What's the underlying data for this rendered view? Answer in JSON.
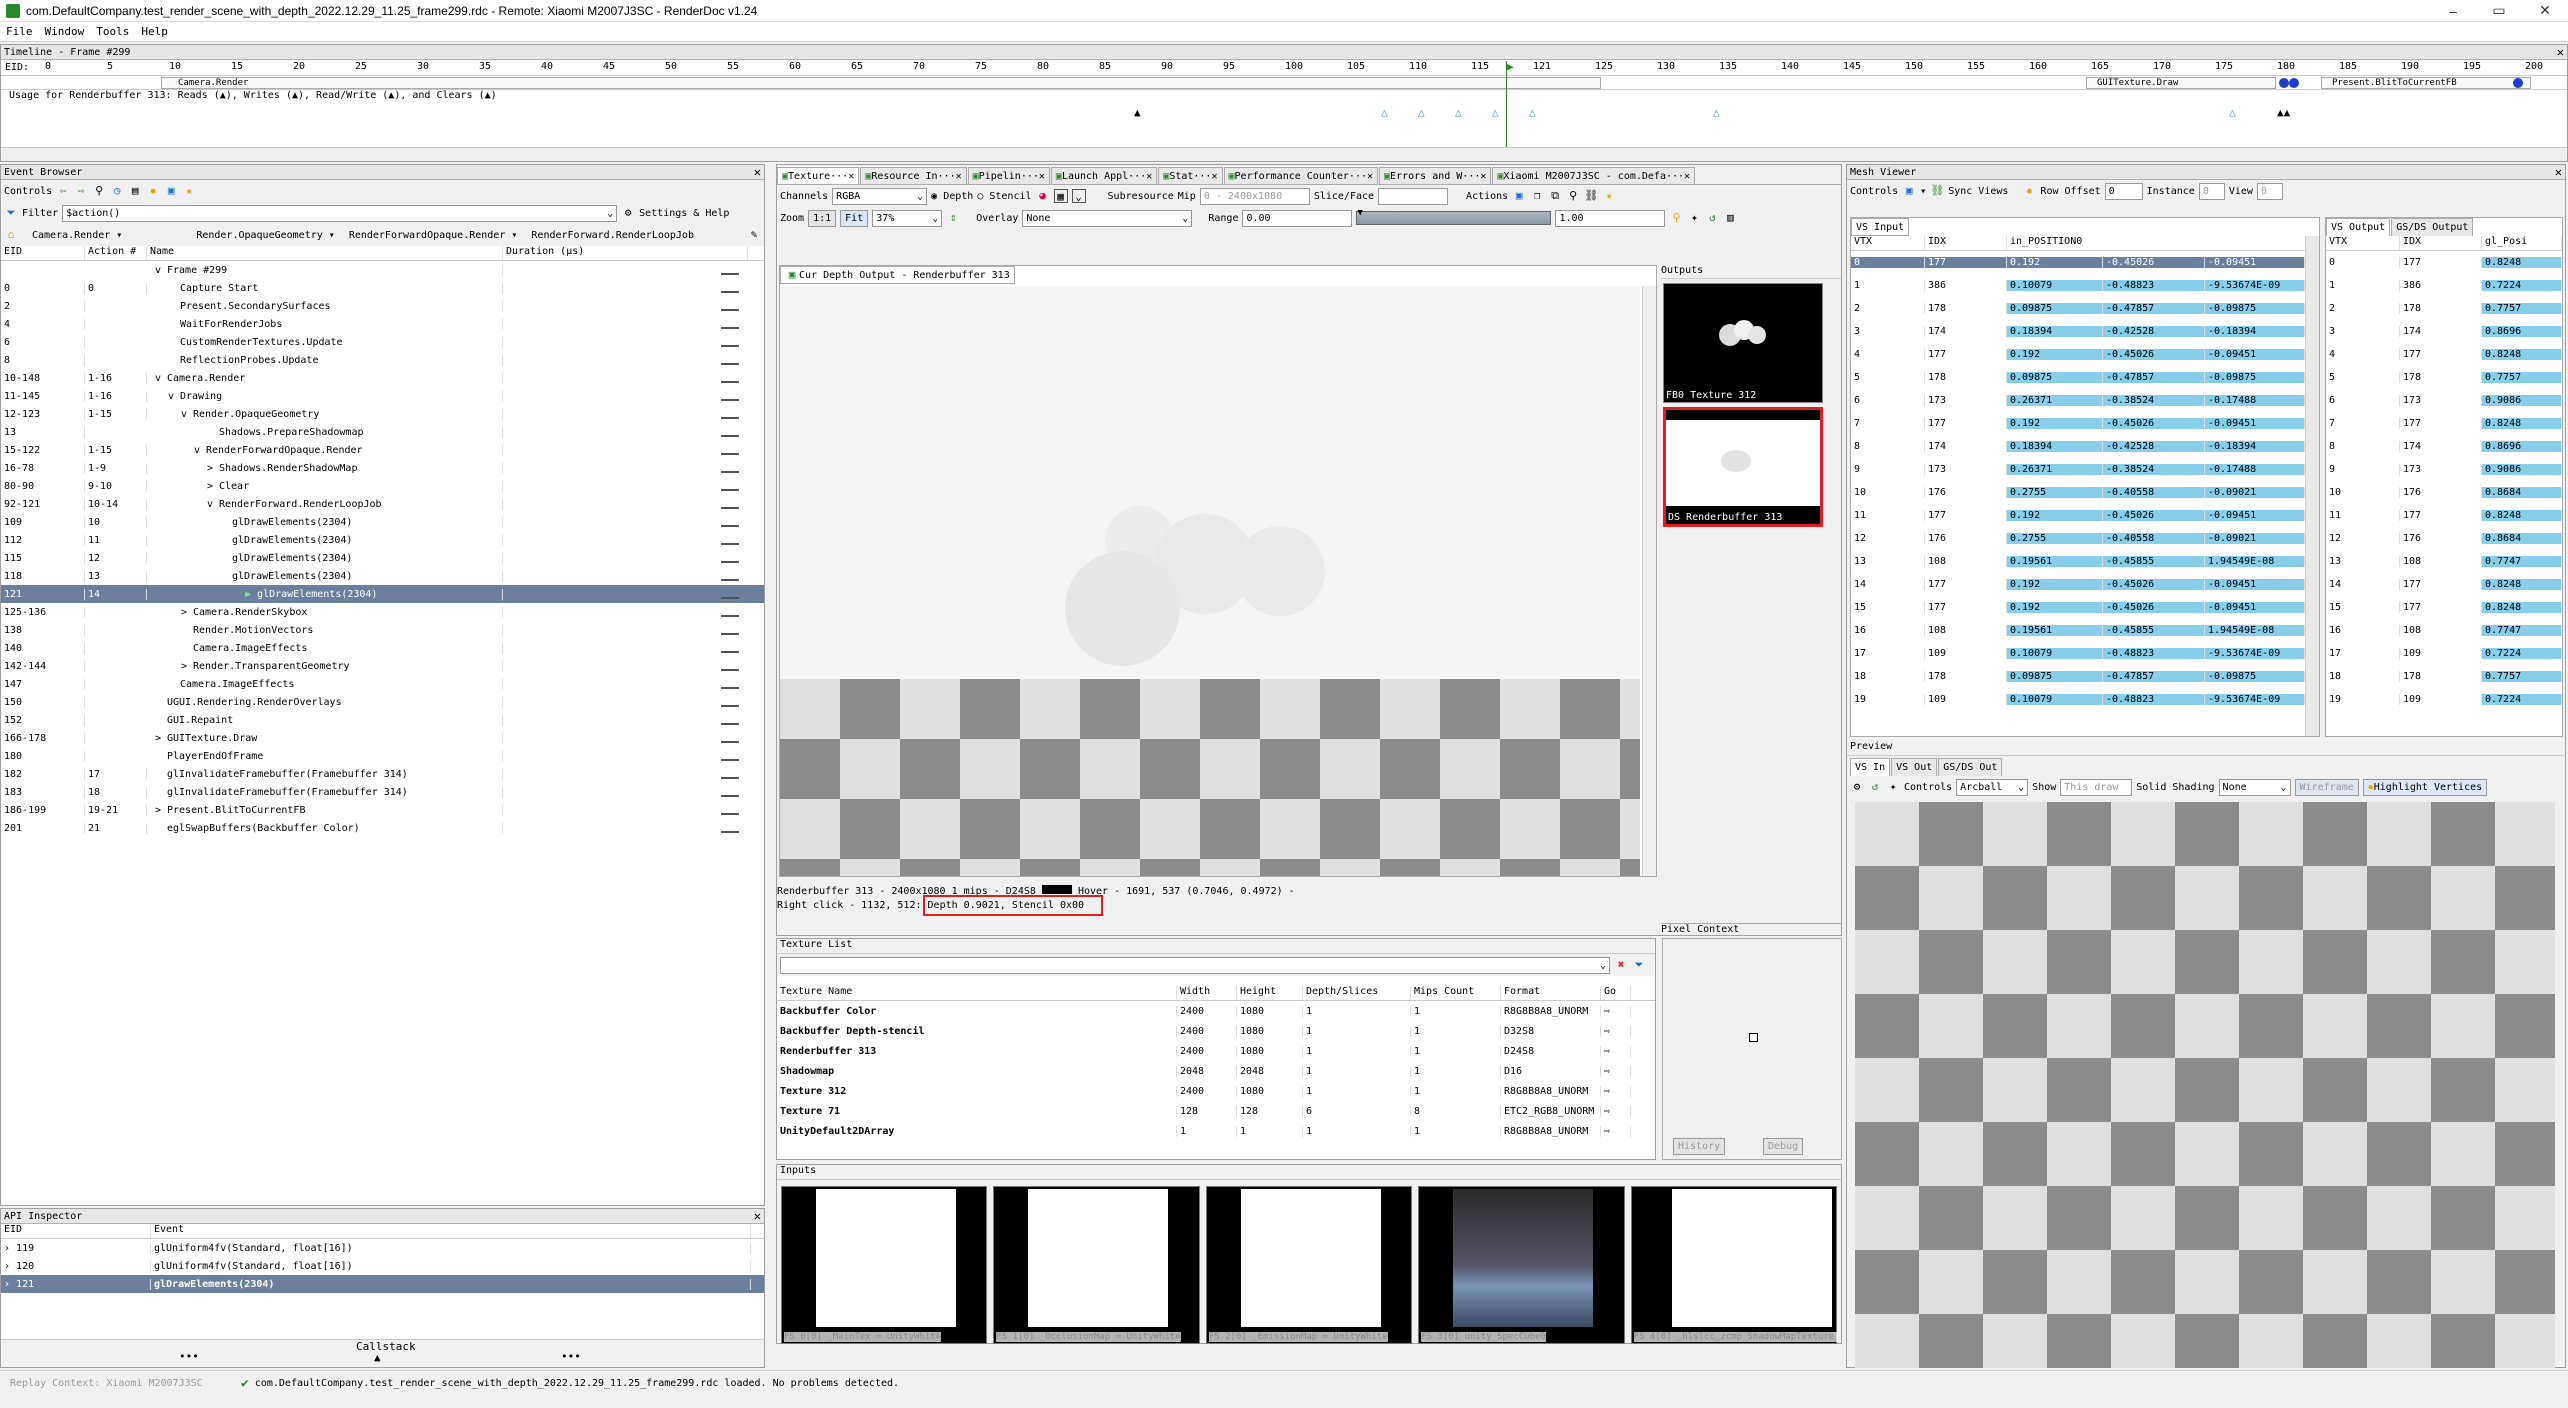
{
  "window": {
    "title": "com.DefaultCompany.test_render_scene_with_depth_2022.12.29_11.25_frame299.rdc - Remote: Xiaomi M2007J3SC - RenderDoc v1.24",
    "min": "–",
    "max": "▭",
    "close": "✕"
  },
  "menu": [
    "File",
    "Window",
    "Tools",
    "Help"
  ],
  "timeline": {
    "title": "Timeline - Frame #299",
    "eid_label": "EID:",
    "ticks": [
      "0",
      "5",
      "10",
      "15",
      "20",
      "25",
      "30",
      "35",
      "40",
      "45",
      "50",
      "55",
      "60",
      "65",
      "70",
      "75",
      "80",
      "85",
      "90",
      "95",
      "100",
      "105",
      "110",
      "115",
      "121",
      "125",
      "130",
      "135",
      "140",
      "145",
      "150",
      "155",
      "160",
      "165",
      "170",
      "175",
      "180",
      "185",
      "190",
      "195",
      "200"
    ],
    "camera": "Camera.Render",
    "guitex": "GUITexture.Draw",
    "present": "Present.BlitToCurrentFB",
    "usage": "Usage for Renderbuffer 313: Reads (▲), Writes (▲), Read/Write (▲), and Clears (▲)"
  },
  "event_browser": {
    "title": "Event Browser",
    "controls": "Controls",
    "filter_label": "Filter",
    "filter_value": "$action()",
    "settings": "Settings & Help",
    "crumbs": [
      "Camera.Render",
      "Render.OpaqueGeometry",
      "RenderForwardOpaque.Render",
      "RenderForward.RenderLoopJob"
    ],
    "headers": [
      "EID",
      "Action #",
      "Name",
      "Duration (µs)"
    ],
    "rows": [
      {
        "eid": "",
        "act": "",
        "name": "Frame #299",
        "ind": 0,
        "exp": "v"
      },
      {
        "eid": "0",
        "act": "0",
        "name": "Capture Start",
        "ind": 1,
        "exp": ""
      },
      {
        "eid": "2",
        "act": "",
        "name": "Present.SecondarySurfaces",
        "ind": 1,
        "exp": ""
      },
      {
        "eid": "4",
        "act": "",
        "name": "WaitForRenderJobs",
        "ind": 1,
        "exp": ""
      },
      {
        "eid": "6",
        "act": "",
        "name": "CustomRenderTextures.Update",
        "ind": 1,
        "exp": ""
      },
      {
        "eid": "8",
        "act": "",
        "name": "ReflectionProbes.Update",
        "ind": 1,
        "exp": ""
      },
      {
        "eid": "10-148",
        "act": "1-16",
        "name": "Camera.Render",
        "ind": 0,
        "exp": "v"
      },
      {
        "eid": "11-145",
        "act": "1-16",
        "name": "Drawing",
        "ind": 1,
        "exp": "v"
      },
      {
        "eid": "12-123",
        "act": "1-15",
        "name": "Render.OpaqueGeometry",
        "ind": 2,
        "exp": "v"
      },
      {
        "eid": "13",
        "act": "",
        "name": "Shadows.PrepareShadowmap",
        "ind": 4,
        "exp": ""
      },
      {
        "eid": "15-122",
        "act": "1-15",
        "name": "RenderForwardOpaque.Render",
        "ind": 3,
        "exp": "v"
      },
      {
        "eid": "16-78",
        "act": "1-9",
        "name": "Shadows.RenderShadowMap",
        "ind": 4,
        "exp": ">"
      },
      {
        "eid": "80-90",
        "act": "9-10",
        "name": "Clear",
        "ind": 4,
        "exp": ">"
      },
      {
        "eid": "92-121",
        "act": "10-14",
        "name": "RenderForward.RenderLoopJob",
        "ind": 4,
        "exp": "v"
      },
      {
        "eid": "109",
        "act": "10",
        "name": "glDrawElements(2304)",
        "ind": 5,
        "exp": ""
      },
      {
        "eid": "112",
        "act": "11",
        "name": "glDrawElements(2304)",
        "ind": 5,
        "exp": ""
      },
      {
        "eid": "115",
        "act": "12",
        "name": "glDrawElements(2304)",
        "ind": 5,
        "exp": ""
      },
      {
        "eid": "118",
        "act": "13",
        "name": "glDrawElements(2304)",
        "ind": 5,
        "exp": ""
      },
      {
        "eid": "121",
        "act": "14",
        "name": "glDrawElements(2304)",
        "ind": 6,
        "exp": "",
        "sel": true
      },
      {
        "eid": "125-136",
        "act": "",
        "name": "Camera.RenderSkybox",
        "ind": 2,
        "exp": ">"
      },
      {
        "eid": "138",
        "act": "",
        "name": "Render.MotionVectors",
        "ind": 2,
        "exp": ""
      },
      {
        "eid": "140",
        "act": "",
        "name": "Camera.ImageEffects",
        "ind": 2,
        "exp": ""
      },
      {
        "eid": "142-144",
        "act": "",
        "name": "Render.TransparentGeometry",
        "ind": 2,
        "exp": ">"
      },
      {
        "eid": "147",
        "act": "",
        "name": "Camera.ImageEffects",
        "ind": 1,
        "exp": ""
      },
      {
        "eid": "150",
        "act": "",
        "name": "UGUI.Rendering.RenderOverlays",
        "ind": 0,
        "exp": ""
      },
      {
        "eid": "152",
        "act": "",
        "name": "GUI.Repaint",
        "ind": 0,
        "exp": ""
      },
      {
        "eid": "166-178",
        "act": "",
        "name": "GUITexture.Draw",
        "ind": 0,
        "exp": ">"
      },
      {
        "eid": "180",
        "act": "",
        "name": "PlayerEndOfFrame",
        "ind": 0,
        "exp": ""
      },
      {
        "eid": "182",
        "act": "17",
        "name": "glInvalidateFramebuffer(Framebuffer 314)",
        "ind": 0,
        "exp": ""
      },
      {
        "eid": "183",
        "act": "18",
        "name": "glInvalidateFramebuffer(Framebuffer 314)",
        "ind": 0,
        "exp": ""
      },
      {
        "eid": "186-199",
        "act": "19-21",
        "name": "Present.BlitToCurrentFB",
        "ind": 0,
        "exp": ">"
      },
      {
        "eid": "201",
        "act": "21",
        "name": "eglSwapBuffers(Backbuffer Color)",
        "ind": 0,
        "exp": ""
      }
    ]
  },
  "api_inspector": {
    "title": "API Inspector",
    "headers": [
      "EID",
      "Event"
    ],
    "rows": [
      {
        "eid": "119",
        "ev": "glUniform4fv(Standard,  float[16])"
      },
      {
        "eid": "120",
        "ev": "glUniform4fv(Standard,  float[16])"
      },
      {
        "eid": "121",
        "ev": "glDrawElements(2304)",
        "sel": true
      }
    ],
    "callstack": "Callstack",
    "dots": "•••"
  },
  "texture_viewer": {
    "tabs": [
      "Texture···",
      "Resource In···",
      "Pipelin···",
      "Launch Appl···",
      "Stat···",
      "Performance Counter···",
      "Errors and W···",
      "Xiaomi M2007J3SC - com.Defa···"
    ],
    "channels_label": "Channels",
    "channels": "RGBA",
    "depth": "Depth",
    "stencil": "Stencil",
    "subresource": "Subresource",
    "mip": "Mip",
    "mip_val": "0 - 2400x1080",
    "slice": "Slice/Face",
    "actions": "Actions",
    "zoom_label": "Zoom",
    "zoom_11": "1:1",
    "fit": "Fit",
    "zoom": "37%",
    "overlay_label": "Overlay",
    "overlay": "None",
    "range_label": "Range",
    "range_min": "0.00",
    "range_max": "1.00",
    "subtab": "Cur Depth Output - Renderbuffer 313",
    "outputs_label": "Outputs",
    "out1": "FB0    Texture 312",
    "out2": "DS    Renderbuffer 313",
    "status1": "Renderbuffer 313 - 2400x1080 1 mips - D24S8",
    "status1b": "Hover -   1691,   537 (0.7046, 0.4972)  -",
    "status2a": "Right click - 1132,   512:",
    "status2b": "Depth 0.9021, Stencil 0x00",
    "pixel_context": "Pixel Context",
    "history": "History",
    "debug": "Debug"
  },
  "texture_list": {
    "title": "Texture List",
    "headers": [
      "Texture Name",
      "Width",
      "Height",
      "Depth/Slices",
      "Mips Count",
      "Format",
      "Go"
    ],
    "rows": [
      [
        "Backbuffer Color",
        "2400",
        "1080",
        "1",
        "1",
        "R8G8B8A8_UNORM"
      ],
      [
        "Backbuffer Depth-stencil",
        "2400",
        "1080",
        "1",
        "1",
        "D32S8"
      ],
      [
        "Renderbuffer 313",
        "2400",
        "1080",
        "1",
        "1",
        "D24S8"
      ],
      [
        "Shadowmap",
        "2048",
        "2048",
        "1",
        "1",
        "D16"
      ],
      [
        "Texture 312",
        "2400",
        "1080",
        "1",
        "1",
        "R8G8B8A8_UNORM"
      ],
      [
        "Texture 71",
        "128",
        "128",
        "6",
        "8",
        "ETC2_RGB8_UNORM"
      ],
      [
        "UnityDefault2DArray",
        "1",
        "1",
        "1",
        "1",
        "R8G8B8A8_UNORM"
      ]
    ]
  },
  "inputs": {
    "title": "Inputs",
    "items": [
      "FS 0[0]    _MainTex = UnityWhite",
      "FS 1[0] _OcclusionMap = UnityWhite",
      "FS 2[0] _EmissionMap = UnityWhite",
      "FS 3[0]    unity_SpecCube0",
      "FS 4[0]  _hlslcc_zcmp_ShadowMapTexture = Shadowmap"
    ]
  },
  "mesh_viewer": {
    "title": "Mesh Viewer",
    "controls": "Controls",
    "sync": "Sync Views",
    "row_offset": "Row Offset",
    "row_offset_val": "0",
    "instance": "Instance",
    "instance_val": "0",
    "view": "View",
    "view_val": "0",
    "vs_input": "VS Input",
    "vs_output": "VS Output",
    "gsds_output": "GS/DS Output",
    "in_headers": [
      "VTX",
      "IDX",
      "in_POSITION0"
    ],
    "out_headers": [
      "VTX",
      "IDX",
      "gl_Posi"
    ],
    "rows": [
      [
        "0",
        "177",
        "0.192",
        "-0.45026",
        "-0.09451",
        "0.8248"
      ],
      [
        "1",
        "386",
        "0.10079",
        "-0.48823",
        "-9.53674E-09",
        "0.7224"
      ],
      [
        "2",
        "178",
        "0.09875",
        "-0.47857",
        "-0.09875",
        "0.7757"
      ],
      [
        "3",
        "174",
        "0.18394",
        "-0.42528",
        "-0.18394",
        "0.8696"
      ],
      [
        "4",
        "177",
        "0.192",
        "-0.45026",
        "-0.09451",
        "0.8248"
      ],
      [
        "5",
        "178",
        "0.09875",
        "-0.47857",
        "-0.09875",
        "0.7757"
      ],
      [
        "6",
        "173",
        "0.26371",
        "-0.38524",
        "-0.17488",
        "0.9086"
      ],
      [
        "7",
        "177",
        "0.192",
        "-0.45026",
        "-0.09451",
        "0.8248"
      ],
      [
        "8",
        "174",
        "0.18394",
        "-0.42528",
        "-0.18394",
        "0.8696"
      ],
      [
        "9",
        "173",
        "0.26371",
        "-0.38524",
        "-0.17488",
        "0.9086"
      ],
      [
        "10",
        "176",
        "0.2755",
        "-0.40558",
        "-0.09021",
        "0.8684"
      ],
      [
        "11",
        "177",
        "0.192",
        "-0.45026",
        "-0.09451",
        "0.8248"
      ],
      [
        "12",
        "176",
        "0.2755",
        "-0.40558",
        "-0.09021",
        "0.8684"
      ],
      [
        "13",
        "108",
        "0.19561",
        "-0.45855",
        "1.94549E-08",
        "0.7747"
      ],
      [
        "14",
        "177",
        "0.192",
        "-0.45026",
        "-0.09451",
        "0.8248"
      ],
      [
        "15",
        "177",
        "0.192",
        "-0.45026",
        "-0.09451",
        "0.8248"
      ],
      [
        "16",
        "108",
        "0.19561",
        "-0.45855",
        "1.94549E-08",
        "0.7747"
      ],
      [
        "17",
        "109",
        "0.10079",
        "-0.48823",
        "-9.53674E-09",
        "0.7224"
      ],
      [
        "18",
        "178",
        "0.09875",
        "-0.47857",
        "-0.09875",
        "0.7757"
      ],
      [
        "19",
        "109",
        "0.10079",
        "-0.48823",
        "-9.53674E-09",
        "0.7224"
      ]
    ],
    "preview": "Preview",
    "ptabs": [
      "VS In",
      "VS Out",
      "GS/DS Out"
    ],
    "pcontrols": "Controls",
    "arcball": "Arcball",
    "show": "Show",
    "show_val": "This draw",
    "solid": "Solid Shading",
    "solid_val": "None",
    "wireframe": "Wireframe",
    "highlight": "Highlight Vertices"
  },
  "statusbar": {
    "replay": "Replay Context: Xiaomi M2007J3SC",
    "msg": "com.DefaultCompany.test_render_scene_with_depth_2022.12.29_11.25_frame299.rdc loaded. No problems detected."
  }
}
